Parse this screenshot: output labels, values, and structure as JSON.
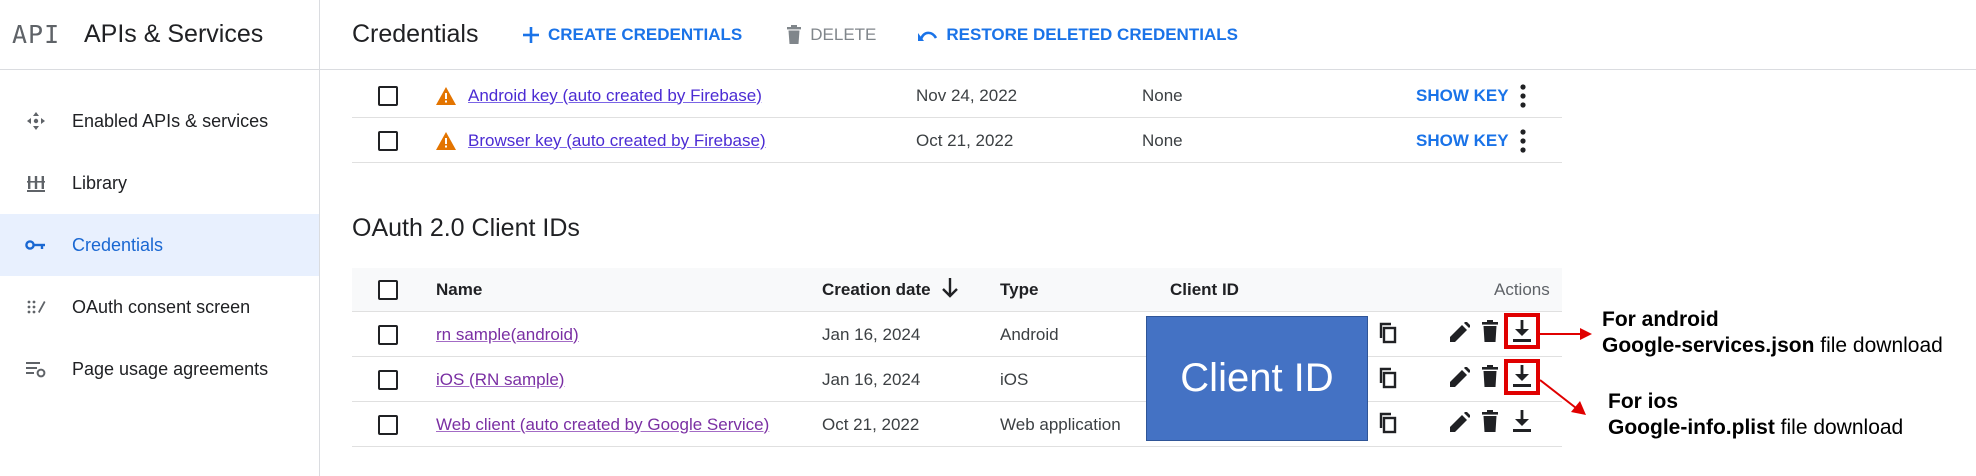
{
  "sidebar": {
    "logo": "API",
    "title": "APIs & Services",
    "items": [
      {
        "label": "Enabled APIs & services",
        "icon": "enabled-apis-icon",
        "active": false
      },
      {
        "label": "Library",
        "icon": "library-icon",
        "active": false
      },
      {
        "label": "Credentials",
        "icon": "key-icon",
        "active": true
      },
      {
        "label": "OAuth consent screen",
        "icon": "oauth-consent-icon",
        "active": false
      },
      {
        "label": "Page usage agreements",
        "icon": "settings-list-icon",
        "active": false
      }
    ]
  },
  "toolbar": {
    "title": "Credentials",
    "create_label": "CREATE CREDENTIALS",
    "delete_label": "DELETE",
    "restore_label": "RESTORE DELETED CREDENTIALS"
  },
  "api_keys": [
    {
      "name": "Android key (auto created by Firebase)",
      "date": "Nov 24, 2022",
      "restrictions": "None",
      "action": "SHOW KEY"
    },
    {
      "name": "Browser key (auto created by Firebase)",
      "date": "Oct 21, 2022",
      "restrictions": "None",
      "action": "SHOW KEY"
    }
  ],
  "oauth": {
    "section_title": "OAuth 2.0 Client IDs",
    "columns": {
      "name": "Name",
      "date": "Creation date",
      "type": "Type",
      "client_id": "Client ID",
      "actions": "Actions"
    },
    "rows": [
      {
        "name": "rn sample(android)",
        "date": "Jan 16, 2024",
        "type": "Android"
      },
      {
        "name": "iOS (RN sample)",
        "date": "Jan 16, 2024",
        "type": "iOS"
      },
      {
        "name": "Web client (auto created by Google Service)",
        "date": "Oct 21, 2022",
        "type": "Web application"
      }
    ],
    "client_id_overlay": "Client ID"
  },
  "annotations": {
    "android_line1": "For android",
    "android_bold": "Google-services.json",
    "android_rest": " file download",
    "ios_line1": "For ios",
    "ios_bold": "Google-info.plist",
    "ios_rest": " file download"
  },
  "colors": {
    "accent": "#1a73e8",
    "active_bg": "#e8f0fe",
    "warning": "#e37400",
    "overlay": "#4472c4",
    "highlight": "#e00000"
  }
}
